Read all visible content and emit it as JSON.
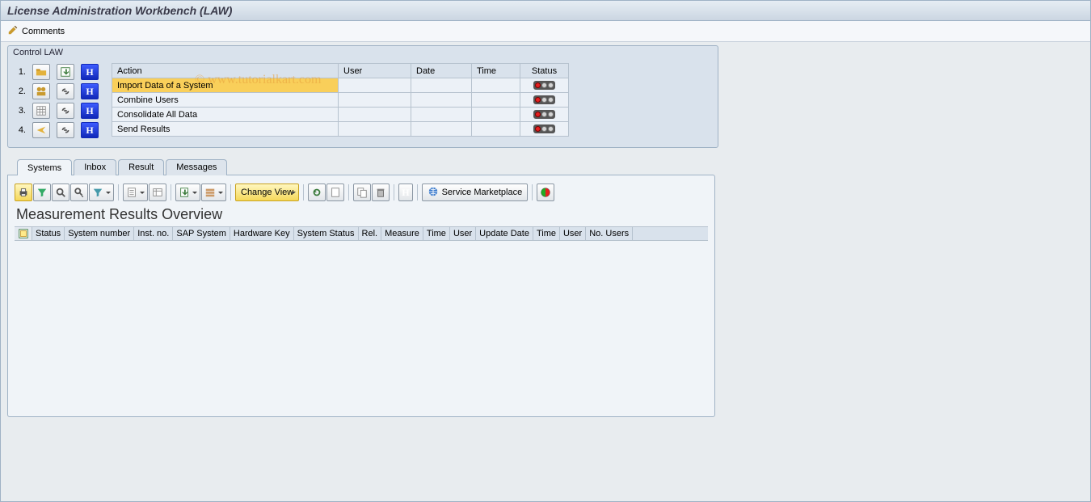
{
  "title": "License Administration Workbench (LAW)",
  "toolbar": {
    "comments_label": "Comments"
  },
  "watermark": "© www.tutorialkart.com",
  "control_panel": {
    "title": "Control LAW",
    "rows": [
      "1.",
      "2.",
      "3.",
      "4."
    ],
    "table": {
      "headers": {
        "action": "Action",
        "user": "User",
        "date": "Date",
        "time": "Time",
        "status": "Status"
      },
      "items": [
        {
          "action": "Import Data of a System",
          "user": "",
          "date": "",
          "time": "",
          "status": "red",
          "highlight": true
        },
        {
          "action": "Combine Users",
          "user": "",
          "date": "",
          "time": "",
          "status": "red",
          "highlight": false
        },
        {
          "action": "Consolidate All Data",
          "user": "",
          "date": "",
          "time": "",
          "status": "red",
          "highlight": false
        },
        {
          "action": "Send Results",
          "user": "",
          "date": "",
          "time": "",
          "status": "red",
          "highlight": false
        }
      ]
    }
  },
  "tabs": {
    "items": [
      {
        "label": "Systems",
        "active": true
      },
      {
        "label": "Inbox",
        "active": false
      },
      {
        "label": "Result",
        "active": false
      },
      {
        "label": "Messages",
        "active": false
      }
    ]
  },
  "alv": {
    "change_view_label": "Change View",
    "service_marketplace_label": "Service Marketplace",
    "overview_title": "Measurement Results Overview",
    "columns": [
      "Status",
      "System number",
      "Inst. no.",
      "SAP System",
      "Hardware Key",
      "System Status",
      "Rel.",
      "Measure",
      "Time",
      "User",
      "Update Date",
      "Time",
      "User",
      "No. Users"
    ]
  }
}
